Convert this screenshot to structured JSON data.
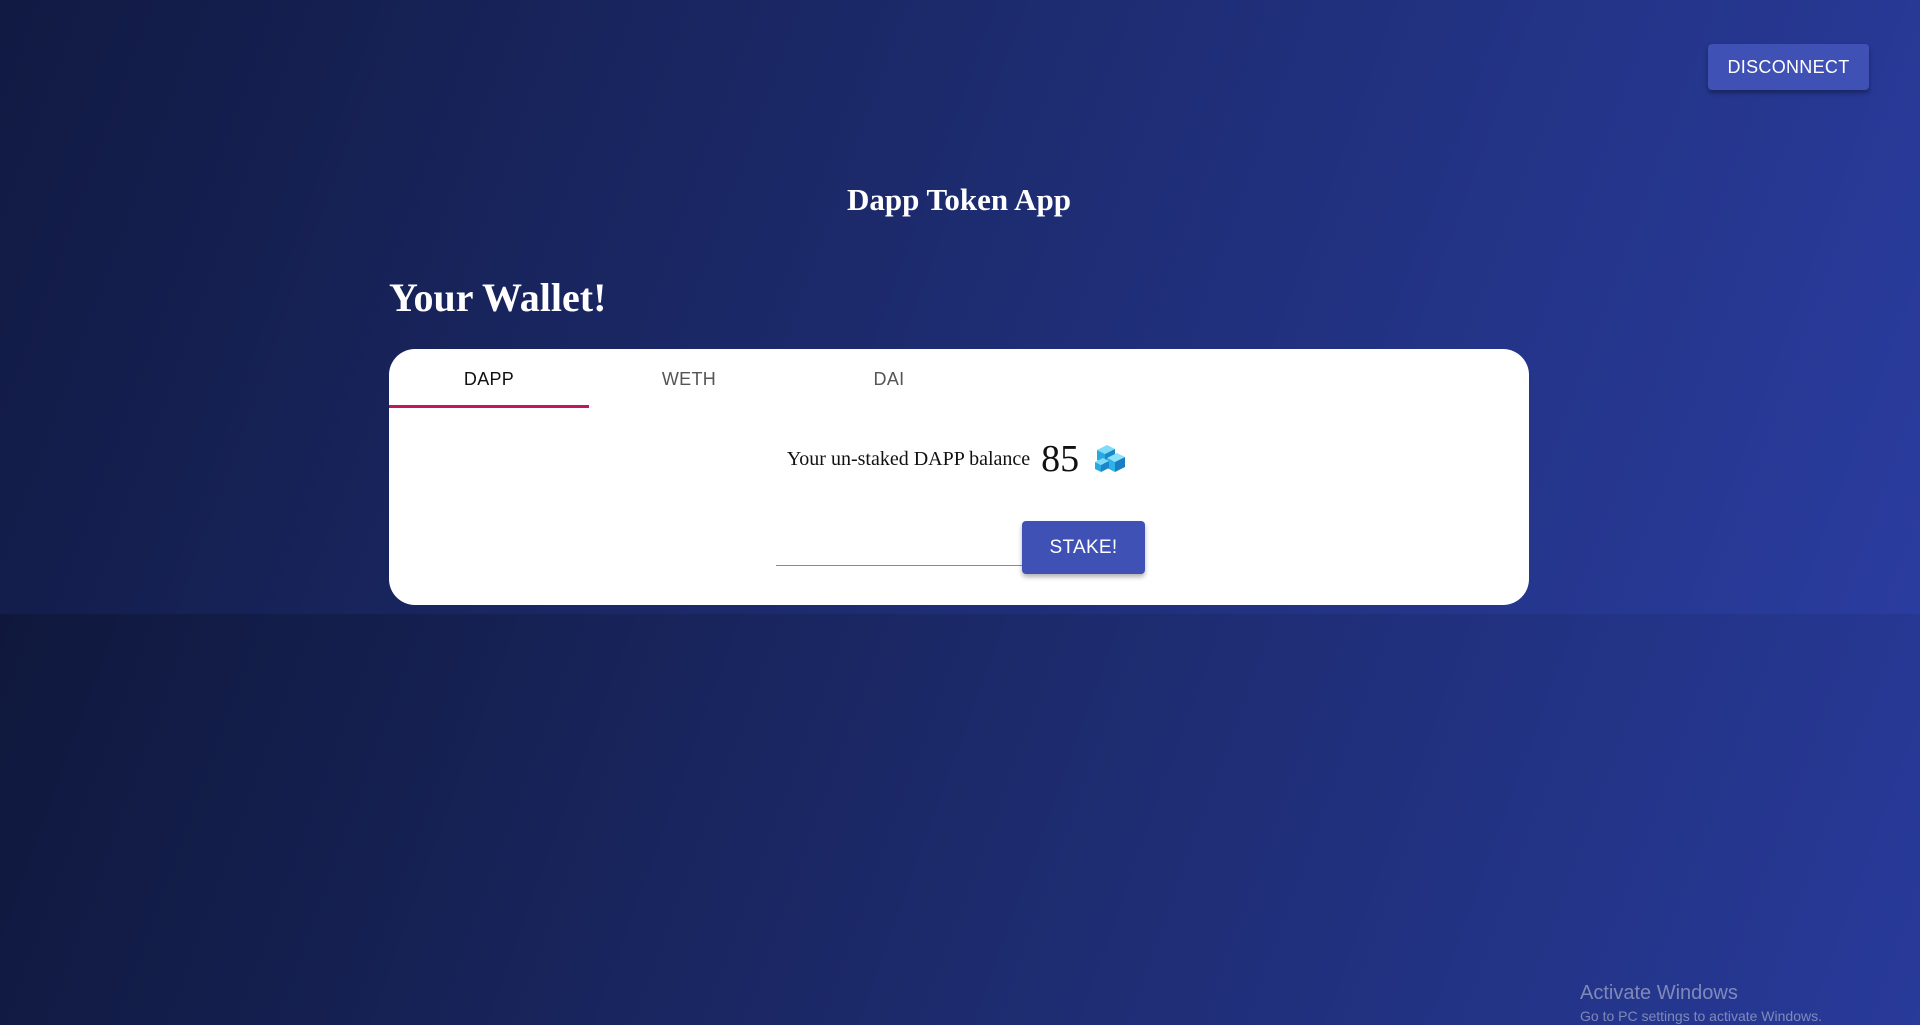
{
  "header": {
    "disconnect_label": "DISCONNECT",
    "app_title": "Dapp Token App"
  },
  "wallet": {
    "title": "Your Wallet!",
    "tabs": [
      {
        "label": "DAPP",
        "selected": true
      },
      {
        "label": "WETH",
        "selected": false
      },
      {
        "label": "DAI",
        "selected": false
      }
    ],
    "balance_label": "Your un-staked DAPP balance",
    "balance_value": "85",
    "token_icon": "dapp-token-icon",
    "amount_input": {
      "value": "",
      "placeholder": ""
    },
    "stake_label": "STAKE!"
  },
  "watermark": {
    "title": "Activate Windows",
    "subtitle": "Go to PC settings to activate Windows."
  },
  "colors": {
    "button": "#3f51b5",
    "tab_indicator": "#c2185b",
    "background_dark": "#101a3f",
    "background_light": "#27399a"
  }
}
